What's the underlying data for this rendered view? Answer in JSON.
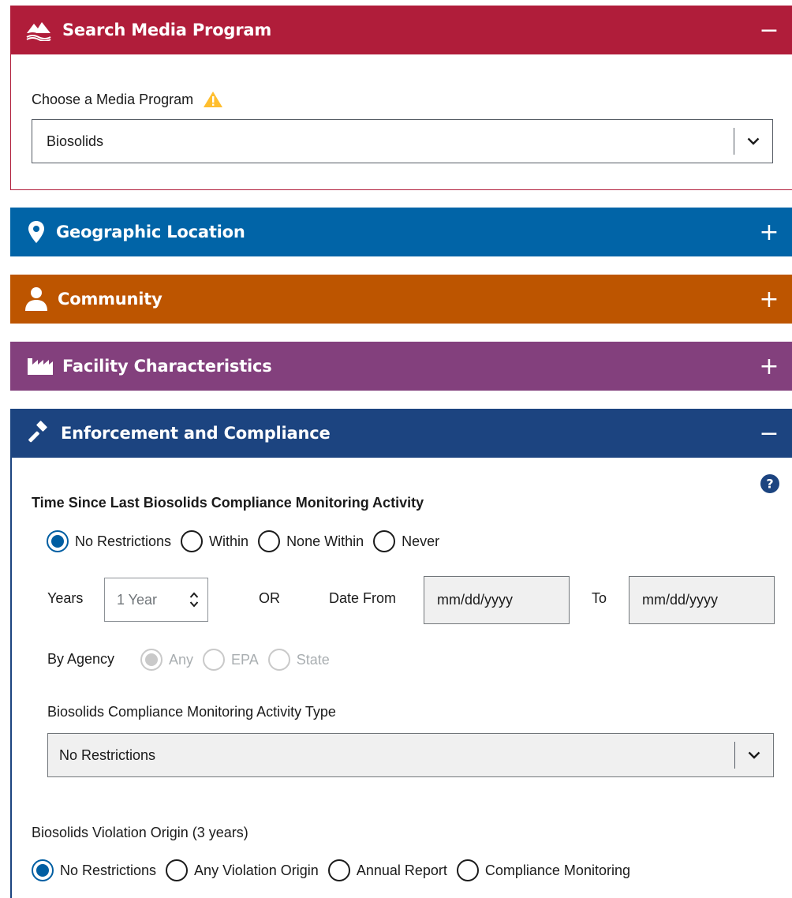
{
  "colors": {
    "search": "#b01d3a",
    "geo": "#0164a7",
    "community": "#bd5500",
    "facility": "#83407d",
    "enforcement": "#1c4480",
    "radio_selected": "#005ea2",
    "warning": "#ffbe2e"
  },
  "panels": {
    "search": {
      "title": "Search Media Program",
      "toggle": "−",
      "icon": "mountain-logo-icon"
    },
    "geo": {
      "title": "Geographic Location",
      "toggle": "+",
      "icon": "map-pin-icon"
    },
    "community": {
      "title": "Community",
      "toggle": "+",
      "icon": "person-icon"
    },
    "facility": {
      "title": "Facility Characteristics",
      "toggle": "+",
      "icon": "factory-icon"
    },
    "enforcement": {
      "title": "Enforcement and Compliance",
      "toggle": "−",
      "icon": "gavel-icon"
    }
  },
  "media_program": {
    "label": "Choose a Media Program",
    "selected": "Biosolids",
    "warning_icon": "warning-icon"
  },
  "compliance": {
    "heading": "Time Since Last Biosolids Compliance Monitoring Activity",
    "help_icon": "question-icon",
    "radio_options": [
      "No Restrictions",
      "Within",
      "None Within",
      "Never"
    ],
    "radio_selected": "No Restrictions",
    "years_label": "Years",
    "years_value": "1 Year",
    "or_label": "OR",
    "date_from_label": "Date From",
    "date_from_value": "mm/dd/yyyy",
    "to_label": "To",
    "date_to_value": "mm/dd/yyyy",
    "agency_label": "By Agency",
    "agency_options": [
      "Any",
      "EPA",
      "State"
    ],
    "agency_selected": "Any",
    "activity_type_label": "Biosolids Compliance Monitoring Activity Type",
    "activity_type_selected": "No Restrictions"
  },
  "violation": {
    "label": "Biosolids Violation Origin (3 years)",
    "options": [
      "No Restrictions",
      "Any Violation Origin",
      "Annual Report",
      "Compliance Monitoring"
    ],
    "selected": "No Restrictions"
  }
}
